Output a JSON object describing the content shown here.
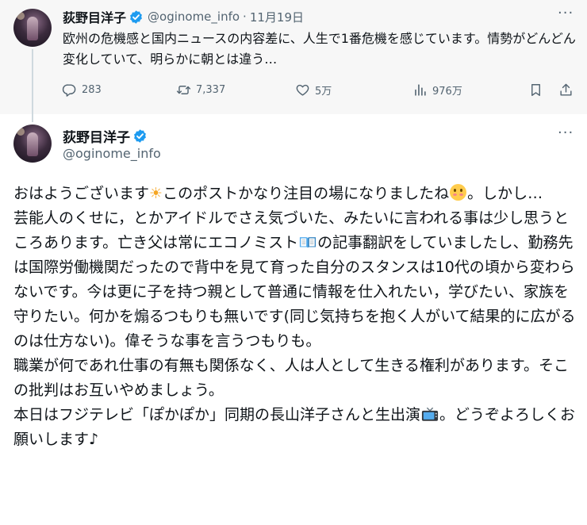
{
  "parent_tweet": {
    "display_name": "荻野目洋子",
    "handle": "@oginome_info",
    "separator": "·",
    "date": "11月19日",
    "more_glyph": "···",
    "text": "欧州の危機感と国内ニュースの内容差に、人生で1番危機を感じています。情勢がどんどん変化していて、明らかに朝とは違う…",
    "stats": {
      "replies": "283",
      "reposts": "7,337",
      "likes": "5万",
      "views": "976万"
    }
  },
  "main_tweet": {
    "display_name": "荻野目洋子",
    "handle": "@oginome_info",
    "more_glyph": "···",
    "body": {
      "l1_a": "おはようございます",
      "sun_emoji": "☀",
      "l1_b": "このポストかなり注目の場になりましたね",
      "l1_c": "。しかし…",
      "p2_a": "芸能人のくせに，とかアイドルでさえ気づいた、みたいに言われる事は少し思うところあります。亡き父は常にエコノミスト",
      "p2_b": "の記事翻訳をしていましたし、勤務先は国際労働機関だったので背中を見て育った自分のスタンスは10代の頃から変わらないです。今は更に子を持つ親として普通に情報を仕入れたい，学びたい、家族を守りたい。何かを煽るつもりも無いです(同じ気持ちを抱く人がいて結果的に広がるのは仕方ない)。偉そうな事を言うつもりも。",
      "p3": "職業が何であれ仕事の有無も関係なく、人は人として生きる権利があります。そこの批判はお互いやめましょう。",
      "p4_a": "本日はフジテレビ「ぽかぽか」同期の長山洋子さんと生出演",
      "p4_b": "。どうぞよろしくお願いします♪"
    }
  },
  "icons": {
    "verified": "verified-badge-icon",
    "reply": "reply-icon",
    "repost": "repost-icon",
    "like": "heart-icon",
    "views": "views-icon",
    "bookmark": "bookmark-icon",
    "share": "share-icon",
    "more": "more-icon"
  },
  "colors": {
    "verified_blue": "#1d9bf0",
    "muted_text": "#536471",
    "parent_background": "#f7f7f7",
    "primary_text": "#0f1419"
  }
}
